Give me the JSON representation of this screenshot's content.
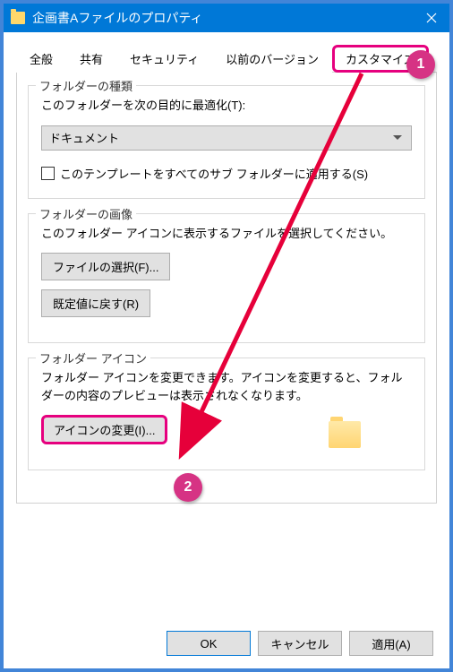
{
  "window": {
    "title": "企画書Aファイルのプロパティ"
  },
  "tabs": {
    "general": "全般",
    "sharing": "共有",
    "security": "セキュリティ",
    "previous": "以前のバージョン",
    "customize": "カスタマイズ"
  },
  "folderType": {
    "title": "フォルダーの種類",
    "optimizeLabel": "このフォルダーを次の目的に最適化(T):",
    "selectedValue": "ドキュメント",
    "applyTemplateLabel": "このテンプレートをすべてのサブ フォルダーに適用する(S)"
  },
  "folderImage": {
    "title": "フォルダーの画像",
    "description": "このフォルダー アイコンに表示するファイルを選択してください。",
    "selectFileBtn": "ファイルの選択(F)...",
    "resetBtn": "既定値に戻す(R)"
  },
  "folderIcon": {
    "title": "フォルダー アイコン",
    "description": "フォルダー アイコンを変更できます。アイコンを変更すると、フォルダーの内容のプレビューは表示されなくなります。",
    "changeIconBtn": "アイコンの変更(I)..."
  },
  "buttons": {
    "ok": "OK",
    "cancel": "キャンセル",
    "apply": "適用(A)"
  },
  "callouts": {
    "one": "1",
    "two": "2"
  }
}
